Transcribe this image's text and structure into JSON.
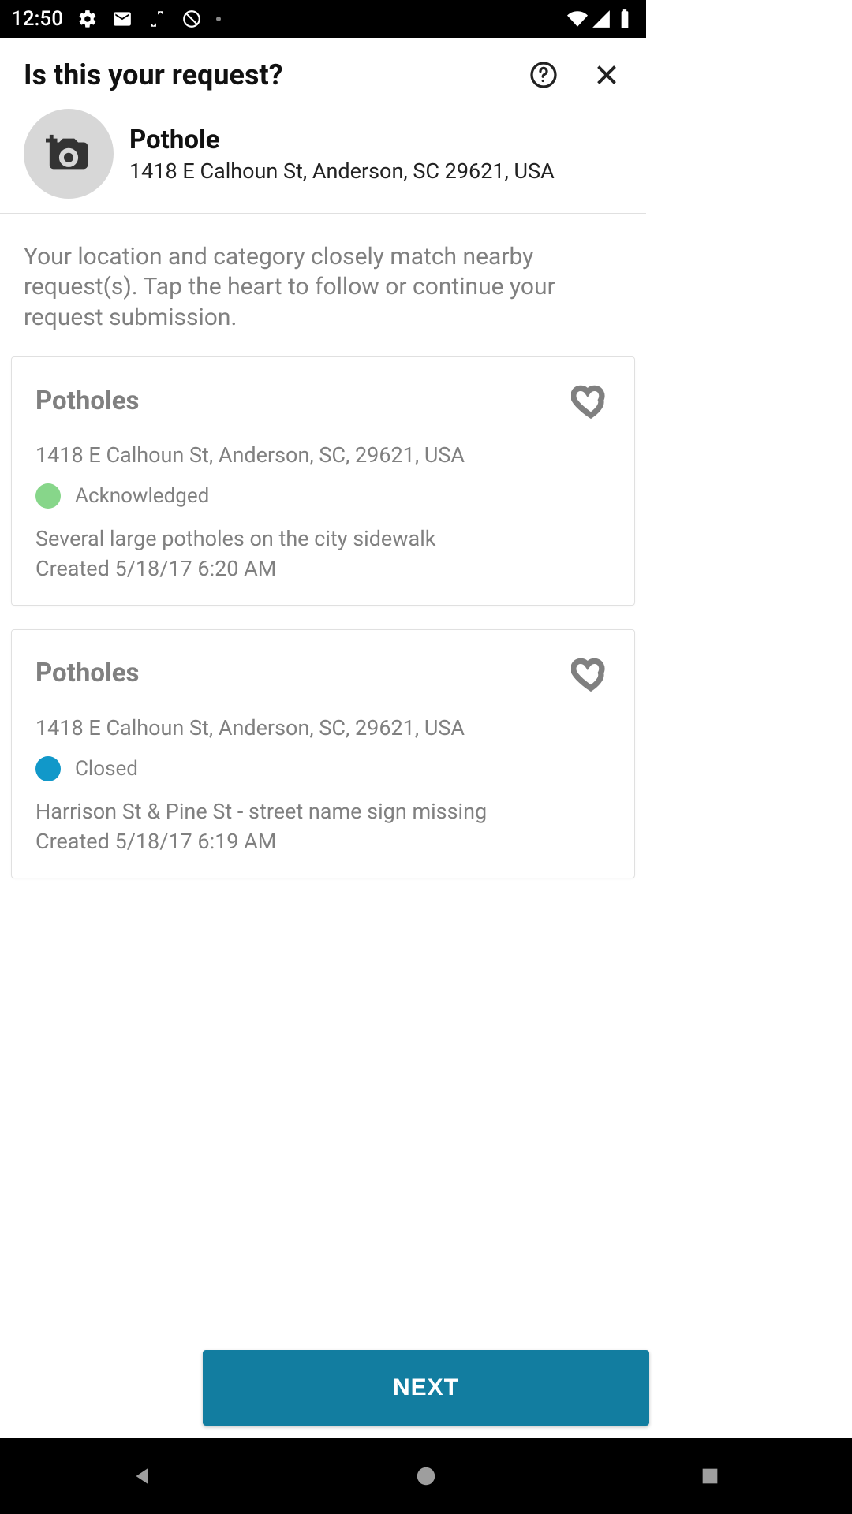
{
  "status_bar": {
    "time": "12:50"
  },
  "header": {
    "title": "Is this your request?"
  },
  "summary": {
    "category": "Pothole",
    "address": "1418 E Calhoun St, Anderson, SC 29621, USA"
  },
  "instruction": "Your location and category closely match nearby request(s). Tap the heart to follow or continue your request submission.",
  "colors": {
    "acknowledged": "#87d68a",
    "closed": "#1198c9"
  },
  "requests": [
    {
      "title": "Potholes",
      "address": "1418 E Calhoun St, Anderson, SC, 29621, USA",
      "status": "Acknowledged",
      "status_color": "acknowledged",
      "description": "Several large potholes on the city sidewalk",
      "created": "Created 5/18/17 6:20 AM"
    },
    {
      "title": "Potholes",
      "address": "1418 E Calhoun St, Anderson, SC, 29621, USA",
      "status": "Closed",
      "status_color": "closed",
      "description": "Harrison St & Pine St - street name sign missing",
      "created": "Created 5/18/17 6:19 AM"
    }
  ],
  "footer": {
    "next_label": "NEXT"
  }
}
